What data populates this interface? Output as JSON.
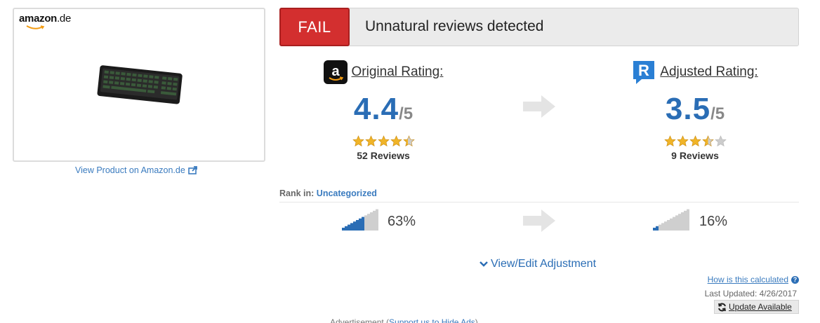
{
  "product": {
    "store_logo_brand": "amazon",
    "store_logo_tld": ".de",
    "image_icon": "keyboard-image",
    "view_link": "View Product on Amazon.de",
    "link_icon": "external-link-icon"
  },
  "banner": {
    "status": "FAIL",
    "message": "Unnatural reviews detected",
    "status_color": "#d32f2f"
  },
  "original": {
    "label": "Original Rating:",
    "icon": "amazon-icon",
    "score": "4.4",
    "out_of": "/5",
    "stars": 4.4,
    "reviews": "52 Reviews",
    "rank_pct": "63%",
    "rank_fill": 0.63
  },
  "adjusted": {
    "label": "Adjusted Rating:",
    "icon": "reviewmeta-icon",
    "score": "3.5",
    "out_of": "/5",
    "stars": 3.5,
    "reviews": "9 Reviews",
    "rank_pct": "16%",
    "rank_fill": 0.16
  },
  "rank": {
    "prefix": "Rank in:",
    "category": "Uncategorized"
  },
  "actions": {
    "view_edit": "View/Edit Adjustment",
    "how_calculated": "How is this calculated",
    "last_updated": "Last Updated: 4/26/2017",
    "update_available": "Update Available"
  },
  "ad": {
    "prefix": "Advertisement (",
    "link": "Support us to Hide Ads",
    "suffix": ")"
  },
  "colors": {
    "accent": "#2a6db5",
    "link": "#3a7bbf",
    "star": "#f0b428",
    "star_empty": "#cccccc",
    "arrow": "#e4e4e4"
  }
}
